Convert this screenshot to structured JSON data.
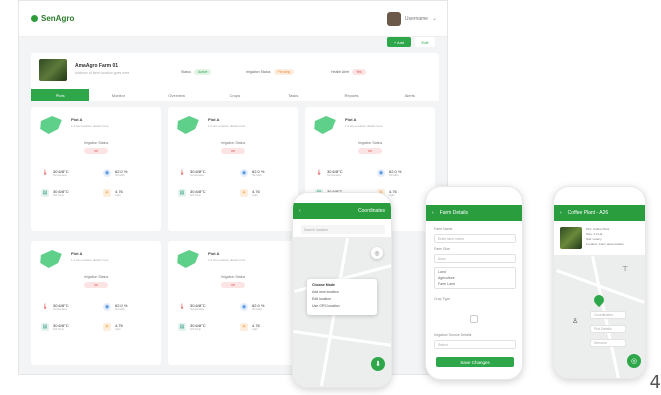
{
  "app": {
    "logo": "SenAgro",
    "user_name": "Username"
  },
  "toolbar": {
    "add": "+ Add",
    "edit": "Edit"
  },
  "farm": {
    "name": "AmaAgro Farm 01",
    "sub": "Address of farm location goes here",
    "stats": [
      {
        "label": "Status",
        "value": "Active",
        "tone": "green"
      },
      {
        "label": "Irrigation Status",
        "value": "Pending",
        "tone": "orange"
      },
      {
        "label": "Health Alert",
        "value": "Yes",
        "tone": "red"
      }
    ]
  },
  "tabs": [
    "Plots",
    "Monitor",
    "Overview",
    "Crops",
    "Tasks",
    "Reports",
    "Alerts"
  ],
  "plots": [
    {
      "title": "Plot A",
      "sub": "1.2 Ha  Location details here",
      "irrigation_label": "Irrigation Status",
      "irrigation_value": "Off",
      "temp": "30.6/8°C",
      "humidity": "62.0 %",
      "soil": "30.6/8°C",
      "light": "4.76"
    },
    {
      "title": "Plot A",
      "sub": "1.2 Ha  Location details here",
      "irrigation_label": "Irrigation Status",
      "irrigation_value": "Off",
      "temp": "30.6/8°C",
      "humidity": "62.0 %",
      "soil": "30.6/8°C",
      "light": "4.76"
    },
    {
      "title": "Plot A",
      "sub": "1.2 Ha  Location details here",
      "irrigation_label": "Irrigation Status",
      "irrigation_value": "Off",
      "temp": "30.6/8°C",
      "humidity": "62.0 %",
      "soil": "30.6/8°C",
      "light": "4.76"
    },
    {
      "title": "Plot A",
      "sub": "1.2 Ha  Location details here",
      "irrigation_label": "Irrigation Status",
      "irrigation_value": "Off",
      "temp": "30.6/8°C",
      "humidity": "62.0 %",
      "soil": "30.6/8°C",
      "light": "4.76"
    },
    {
      "title": "Plot A",
      "sub": "1.2 Ha  Location details here",
      "irrigation_label": "Irrigation Status",
      "irrigation_value": "Off",
      "temp": "30.6/8°C",
      "humidity": "62.0 %",
      "soil": "30.6/8°C",
      "light": "4.76"
    }
  ],
  "metric_labels": {
    "temp": "Temperature",
    "humidity": "Humidity",
    "soil": "Soil Temp",
    "light": "Light"
  },
  "phone1": {
    "title": "Coordinates",
    "search": "Search location",
    "popup_title": "Choose Mode",
    "popup_items": [
      "Add new location",
      "Edit location",
      "Use GPS location"
    ]
  },
  "phone2": {
    "title": "Farm Details",
    "fields": [
      {
        "label": "Farm Name",
        "value": "Enter farm name"
      },
      {
        "label": "Farm Size",
        "value": "Area"
      }
    ],
    "options": [
      "Land",
      "Agriculture",
      "Farm Land"
    ],
    "crop_label": "Crop Type",
    "irrigation_label": "Irrigation Source Details",
    "irrigation_value": "Select",
    "save": "Save Changes"
  },
  "phone3": {
    "title": "Coffee Plant - A26",
    "info": [
      "Plot: Coffee Plant",
      "Size: 1.2 Ha",
      "Soil: Loamy",
      "Location: Farm area location"
    ],
    "buttons": [
      "Coordinates",
      "Plot Details",
      "Sensors"
    ]
  },
  "page_marker": "4"
}
